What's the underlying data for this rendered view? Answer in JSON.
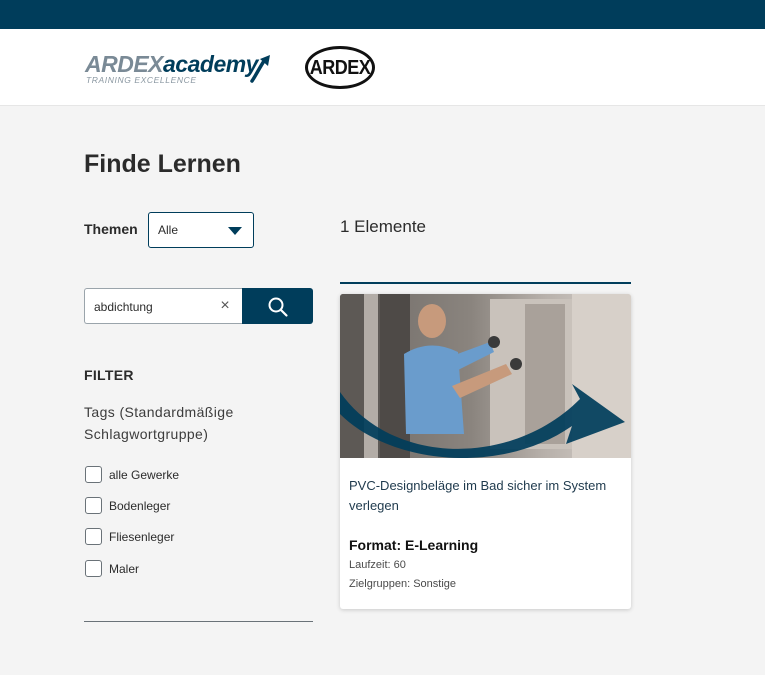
{
  "header": {
    "logo_academy": {
      "brand_part1": "ARDEX",
      "brand_part2": "academy",
      "tagline": "TRAINING EXCELLENCE"
    },
    "logo_ardex": "ARDEX"
  },
  "page": {
    "title": "Finde Lernen"
  },
  "themen": {
    "label": "Themen",
    "selected": "Alle"
  },
  "search": {
    "value": "abdichtung",
    "clear_icon": "×"
  },
  "filter": {
    "heading": "FILTER",
    "tags_title": "Tags (Standardmäßige Schlagwortgruppe)",
    "options": [
      {
        "label": "alle Gewerke",
        "checked": false
      },
      {
        "label": "Bodenleger",
        "checked": false
      },
      {
        "label": "Fliesenleger",
        "checked": false
      },
      {
        "label": "Maler",
        "checked": false
      }
    ]
  },
  "results": {
    "count_label": "1 Elemente",
    "items": [
      {
        "title": "PVC-Designbeläge im Bad sicher im System verlegen",
        "format": "Format: E-Learning",
        "laufzeit": "Laufzeit: 60",
        "zielgruppen": "Zielgruppen: Sonstige",
        "image": "worker-applying-wall-panel-photo"
      }
    ]
  },
  "colors": {
    "primary": "#003d5b",
    "background": "#f4f4f4",
    "card": "#ffffff"
  }
}
